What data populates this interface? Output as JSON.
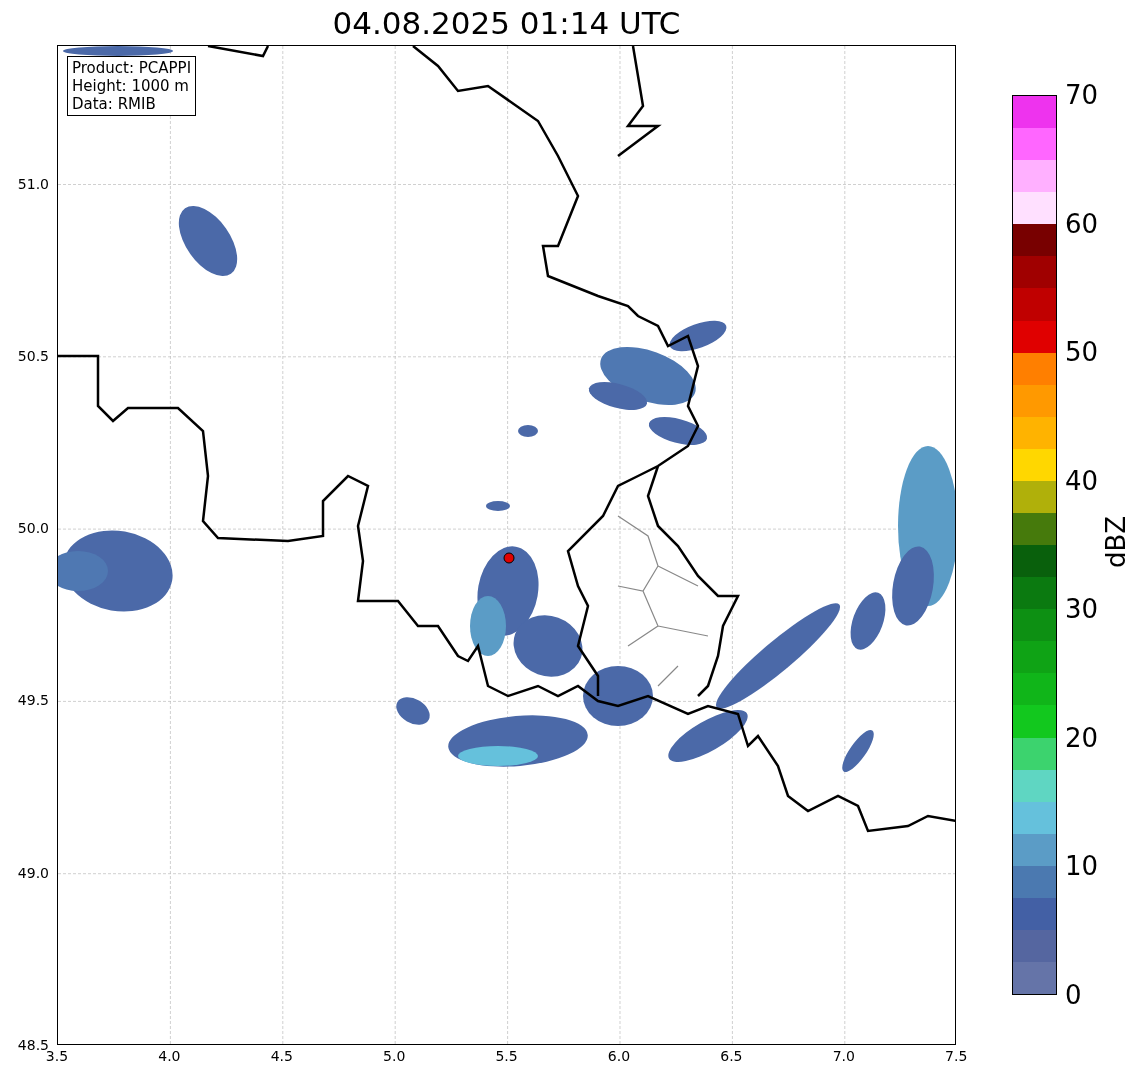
{
  "title": "04.08.2025 01:14 UTC",
  "info_box": {
    "lines": [
      "Product: PCAPPI",
      "Height: 1000 m",
      "Data: RMIB"
    ]
  },
  "map": {
    "x_ticks": [
      "3.5",
      "4.0",
      "4.5",
      "5.0",
      "5.5",
      "6.0",
      "6.5",
      "7.0",
      "7.5"
    ],
    "y_ticks": [
      "51.0",
      "50.5",
      "50.0",
      "49.5",
      "49.0",
      "48.5"
    ]
  },
  "colorbar": {
    "label": "dBZ",
    "ticks": [
      "70",
      "60",
      "50",
      "40",
      "30",
      "20",
      "10",
      "0"
    ],
    "segments": [
      {
        "color": "#6574a8"
      },
      {
        "color": "#5566a0"
      },
      {
        "color": "#4360a5"
      },
      {
        "color": "#4b79b0"
      },
      {
        "color": "#5b9cc6"
      },
      {
        "color": "#65c1dc"
      },
      {
        "color": "#5fd6c2"
      },
      {
        "color": "#3cd36e"
      },
      {
        "color": "#12c81e"
      },
      {
        "color": "#10b519"
      },
      {
        "color": "#0fa315"
      },
      {
        "color": "#0d9013"
      },
      {
        "color": "#0b7a10"
      },
      {
        "color": "#09600c"
      },
      {
        "color": "#467a0c"
      },
      {
        "color": "#b0b00a"
      },
      {
        "color": "#ffd700"
      },
      {
        "color": "#ffb300"
      },
      {
        "color": "#ff9900"
      },
      {
        "color": "#ff7f00"
      },
      {
        "color": "#e00000"
      },
      {
        "color": "#c00000"
      },
      {
        "color": "#a00000"
      },
      {
        "color": "#780000"
      },
      {
        "color": "#ffe0ff"
      },
      {
        "color": "#ffb0ff"
      },
      {
        "color": "#ff66ff"
      },
      {
        "color": "#ee33ee"
      }
    ]
  }
}
